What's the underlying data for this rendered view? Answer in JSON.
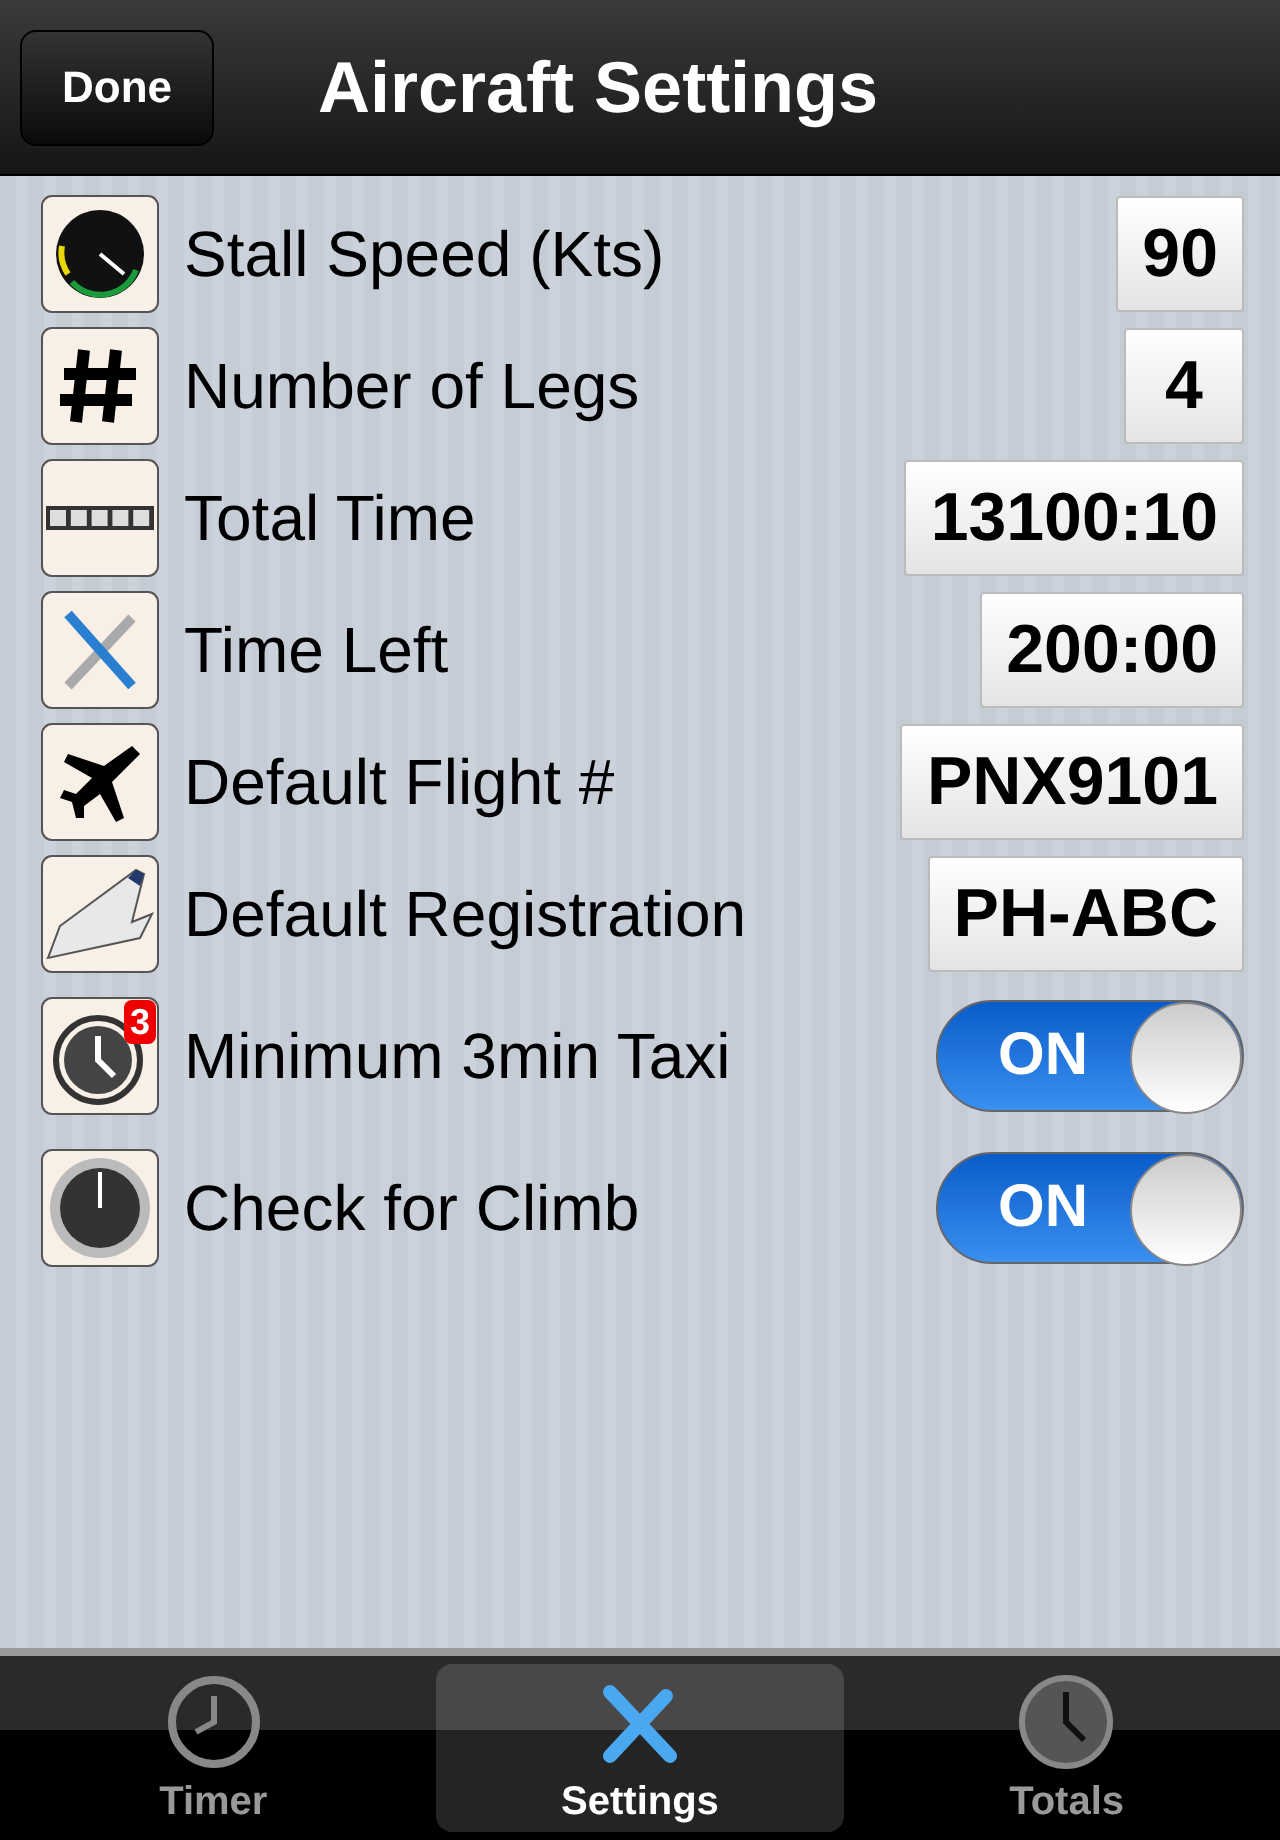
{
  "nav_bar": {
    "title": "Aircraft Settings",
    "done_button": "Done"
  },
  "rows": [
    {
      "kind": "value",
      "label": "Stall Speed (Kts)",
      "value": "90"
    },
    {
      "kind": "value",
      "label": "Number of Legs",
      "value": "4"
    },
    {
      "kind": "value",
      "label": "Total Time",
      "value": "13100:10"
    },
    {
      "kind": "value",
      "label": "Time Left",
      "value": "200:00"
    },
    {
      "kind": "value",
      "label": "Default Flight #",
      "value": "PNX9101"
    },
    {
      "kind": "value",
      "label": "Default Registration",
      "value": "PH-ABC"
    },
    {
      "kind": "toggle",
      "label": "Minimum 3min Taxi",
      "badge": "3",
      "on": true,
      "text": "ON"
    },
    {
      "kind": "toggle",
      "label": "Check for Climb",
      "on": true,
      "text": "ON"
    }
  ],
  "tabs": [
    {
      "label": "Timer",
      "selected": false
    },
    {
      "label": "Settings",
      "selected": true
    },
    {
      "label": "Totals",
      "selected": false
    }
  ]
}
